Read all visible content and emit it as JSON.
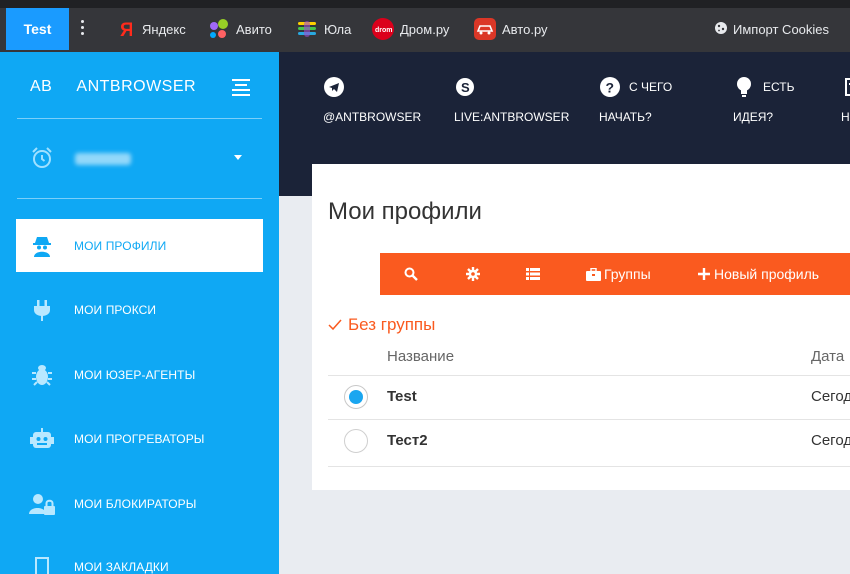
{
  "browser": {
    "active_tab": "Test",
    "bookmarks": [
      {
        "label": "Яндекс",
        "icon": "yandex-icon"
      },
      {
        "label": "Авито",
        "icon": "avito-icon"
      },
      {
        "label": "Юла",
        "icon": "youla-icon"
      },
      {
        "label": "Дром.ру",
        "icon": "drom-icon"
      },
      {
        "label": "Авто.ру",
        "icon": "autoru-icon"
      }
    ],
    "import_cookies": {
      "label": "Импорт Cookies",
      "icon": "cookie-icon"
    }
  },
  "sidebar": {
    "brand_short": "AB",
    "brand_name": "ANTBROWSER",
    "items": [
      {
        "label": "МОИ ПРОФИЛИ",
        "icon": "spy-icon",
        "active": true
      },
      {
        "label": "МОИ ПРОКСИ",
        "icon": "plug-icon"
      },
      {
        "label": "МОИ ЮЗЕР-АГЕНТЫ",
        "icon": "bug-icon"
      },
      {
        "label": "МОИ ПРОГРЕВАТОРЫ",
        "icon": "robot-icon"
      },
      {
        "label": "МОИ БЛОКИРАТОРЫ",
        "icon": "user-lock-icon"
      },
      {
        "label": "МОИ ЗАКЛАДКИ",
        "icon": "bookmark-icon"
      }
    ]
  },
  "header": {
    "items": [
      {
        "top": "",
        "bottom": "@ANTBROWSER",
        "icon": "telegram-icon"
      },
      {
        "top": "",
        "bottom": "LIVE:ANTBROWSER",
        "icon": "skype-icon"
      },
      {
        "top": "С ЧЕГО",
        "bottom": "НАЧАТЬ?",
        "icon": "question-icon"
      },
      {
        "top": "ЕСТЬ",
        "bottom": "ИДЕЯ?",
        "icon": "lightbulb-icon"
      },
      {
        "top": "",
        "bottom": "Н",
        "icon": "news-icon"
      }
    ]
  },
  "main": {
    "title": "Мои профили",
    "toolbar": {
      "groups_label": "Группы",
      "new_profile_label": "Новый профиль"
    },
    "group": {
      "name": "Без группы"
    },
    "columns": {
      "name": "Название",
      "date": "Дата"
    },
    "rows": [
      {
        "name": "Test",
        "date": "Сегод",
        "selected": true
      },
      {
        "name": "Тест2",
        "date": "Сегод",
        "selected": false
      }
    ]
  },
  "colors": {
    "sidebar": "#0fa8f4",
    "header": "#1b2338",
    "accent": "#fa5a1f",
    "tab": "#1a9bff"
  }
}
